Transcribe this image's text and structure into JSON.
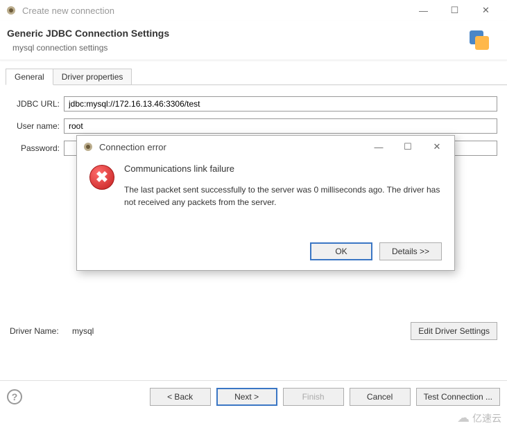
{
  "window": {
    "title": "Create new connection"
  },
  "header": {
    "title": "Generic JDBC Connection Settings",
    "subtitle": "mysql connection settings"
  },
  "tabs": {
    "general": "General",
    "driver_properties": "Driver properties"
  },
  "form": {
    "jdbc_url_label": "JDBC URL:",
    "jdbc_url_value": "jdbc:mysql://172.16.13.46:3306/test",
    "username_label": "User name:",
    "username_value": "root",
    "password_label": "Password:",
    "password_value": ""
  },
  "driver": {
    "label": "Driver Name:",
    "value": "mysql",
    "edit_button": "Edit Driver Settings"
  },
  "footer": {
    "back": "< Back",
    "next": "Next >",
    "finish": "Finish",
    "cancel": "Cancel",
    "test": "Test Connection ..."
  },
  "modal": {
    "title": "Connection error",
    "error_title": "Communications link failure",
    "error_message": "The last packet sent successfully to the server was 0 milliseconds ago. The driver has not received any packets from the server.",
    "ok": "OK",
    "details": "Details >>"
  },
  "watermark": "亿速云"
}
